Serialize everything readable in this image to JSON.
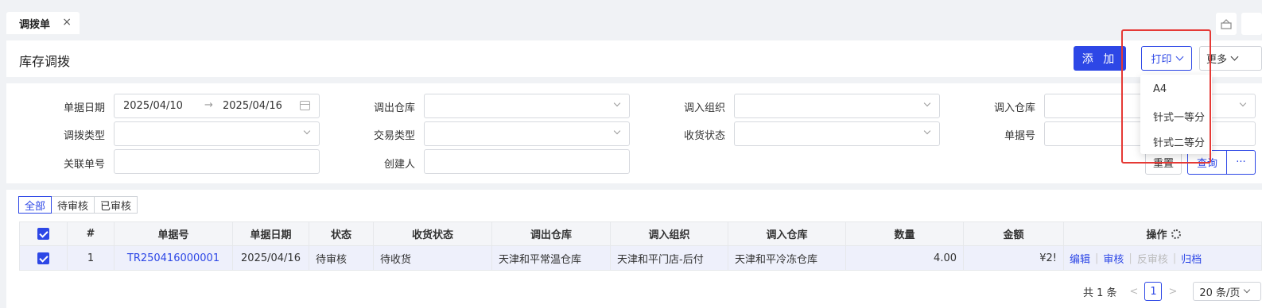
{
  "tabs": [
    {
      "label": "调拨单",
      "close": "×"
    }
  ],
  "page_title": "库存调拨",
  "toolbar": {
    "add_label": "添 加",
    "print_label": "打印",
    "more_label": "更多"
  },
  "print_menu": [
    "A4",
    "针式一等分",
    "针式二等分"
  ],
  "filters": {
    "doc_date_label": "单据日期",
    "date_from": "2025/04/10",
    "date_arrow": "→",
    "date_to": "2025/04/16",
    "out_wh_label": "调出仓库",
    "in_org_label": "调入组织",
    "in_wh_label": "调入仓库",
    "transfer_type_label": "调拨类型",
    "trade_type_label": "交易类型",
    "receive_status_label": "收货状态",
    "doc_no_label": "单据号",
    "related_no_label": "关联单号",
    "creator_label": "创建人",
    "reset_label": "重置",
    "query_label": "查询",
    "more_glyph": "···"
  },
  "status_tabs": [
    "全部",
    "待审核",
    "已审核"
  ],
  "table": {
    "headers": [
      "#",
      "单据号",
      "单据日期",
      "状态",
      "收货状态",
      "调出仓库",
      "调入组织",
      "调入仓库",
      "数量",
      "金额",
      "操作"
    ],
    "rows": [
      {
        "index": "1",
        "doc_no": "TR250416000001",
        "date": "2025/04/16",
        "status": "待审核",
        "receive_status": "待收货",
        "out_wh": "天津和平常温仓库",
        "in_org": "天津和平门店-后付",
        "in_wh": "天津和平冷冻仓库",
        "qty": "4.00",
        "amount": "¥2!",
        "actions": [
          "编辑",
          "审核",
          "反审核",
          "归档"
        ]
      }
    ]
  },
  "pagination": {
    "total": "共 1 条",
    "prev": "<",
    "page": "1",
    "next": ">",
    "page_size": "20 条/页"
  },
  "colors": {
    "primary": "#2d47e6",
    "highlight": "#e53935"
  }
}
